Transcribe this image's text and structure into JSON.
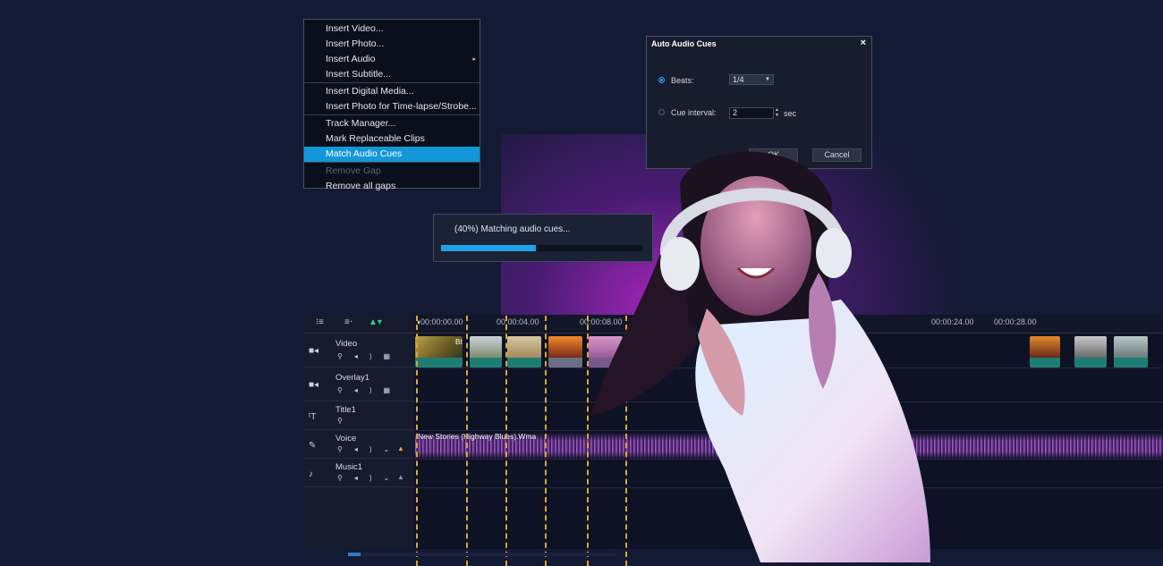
{
  "context_menu": {
    "items": [
      {
        "label": "Insert Video..."
      },
      {
        "label": "Insert Photo..."
      },
      {
        "label": "Insert Audio",
        "submenu_arrow": "▸"
      },
      {
        "label": "Insert Subtitle..."
      },
      {
        "label": "Insert Digital Media..."
      },
      {
        "label": "Insert Photo for Time-lapse/Strobe..."
      },
      {
        "label": "Track Manager..."
      },
      {
        "label": "Mark Replaceable Clips"
      },
      {
        "label": "Match Audio Cues",
        "highlighted": true
      },
      {
        "label": "Remove Gap",
        "disabled": true
      },
      {
        "label": "Remove all gaps"
      }
    ],
    "highlight_color": "#1497d8"
  },
  "dialog": {
    "title": "Auto Audio Cues",
    "close": "×",
    "beats_label": "Beats:",
    "beats_value": "1/4",
    "cue_interval_label": "Cue interval:",
    "cue_interval_value": "2",
    "cue_interval_unit": "sec",
    "ok_label": "OK",
    "cancel_label": "Cancel"
  },
  "progress": {
    "text": "(40%) Matching audio cues...",
    "percent": 0.47
  },
  "timeline": {
    "ruler": [
      "00:00:00.00",
      "00:00:04.00",
      "00:00:08.00",
      "00:00:24.00",
      "00:00:28.00"
    ],
    "tracks": [
      {
        "name": "Video",
        "icon": "video-camera-icon"
      },
      {
        "name": "Overlay1",
        "icon": "video-camera-icon"
      },
      {
        "name": "Title1",
        "icon": "title-icon"
      },
      {
        "name": "Voice",
        "icon": "microphone-icon"
      },
      {
        "name": "Music1",
        "icon": "music-note-icon"
      }
    ],
    "voice_clip_label": "New Stories (Highway Blues).Wma",
    "first_clip_label": "Bt",
    "cue_color": "#e3a33a"
  }
}
